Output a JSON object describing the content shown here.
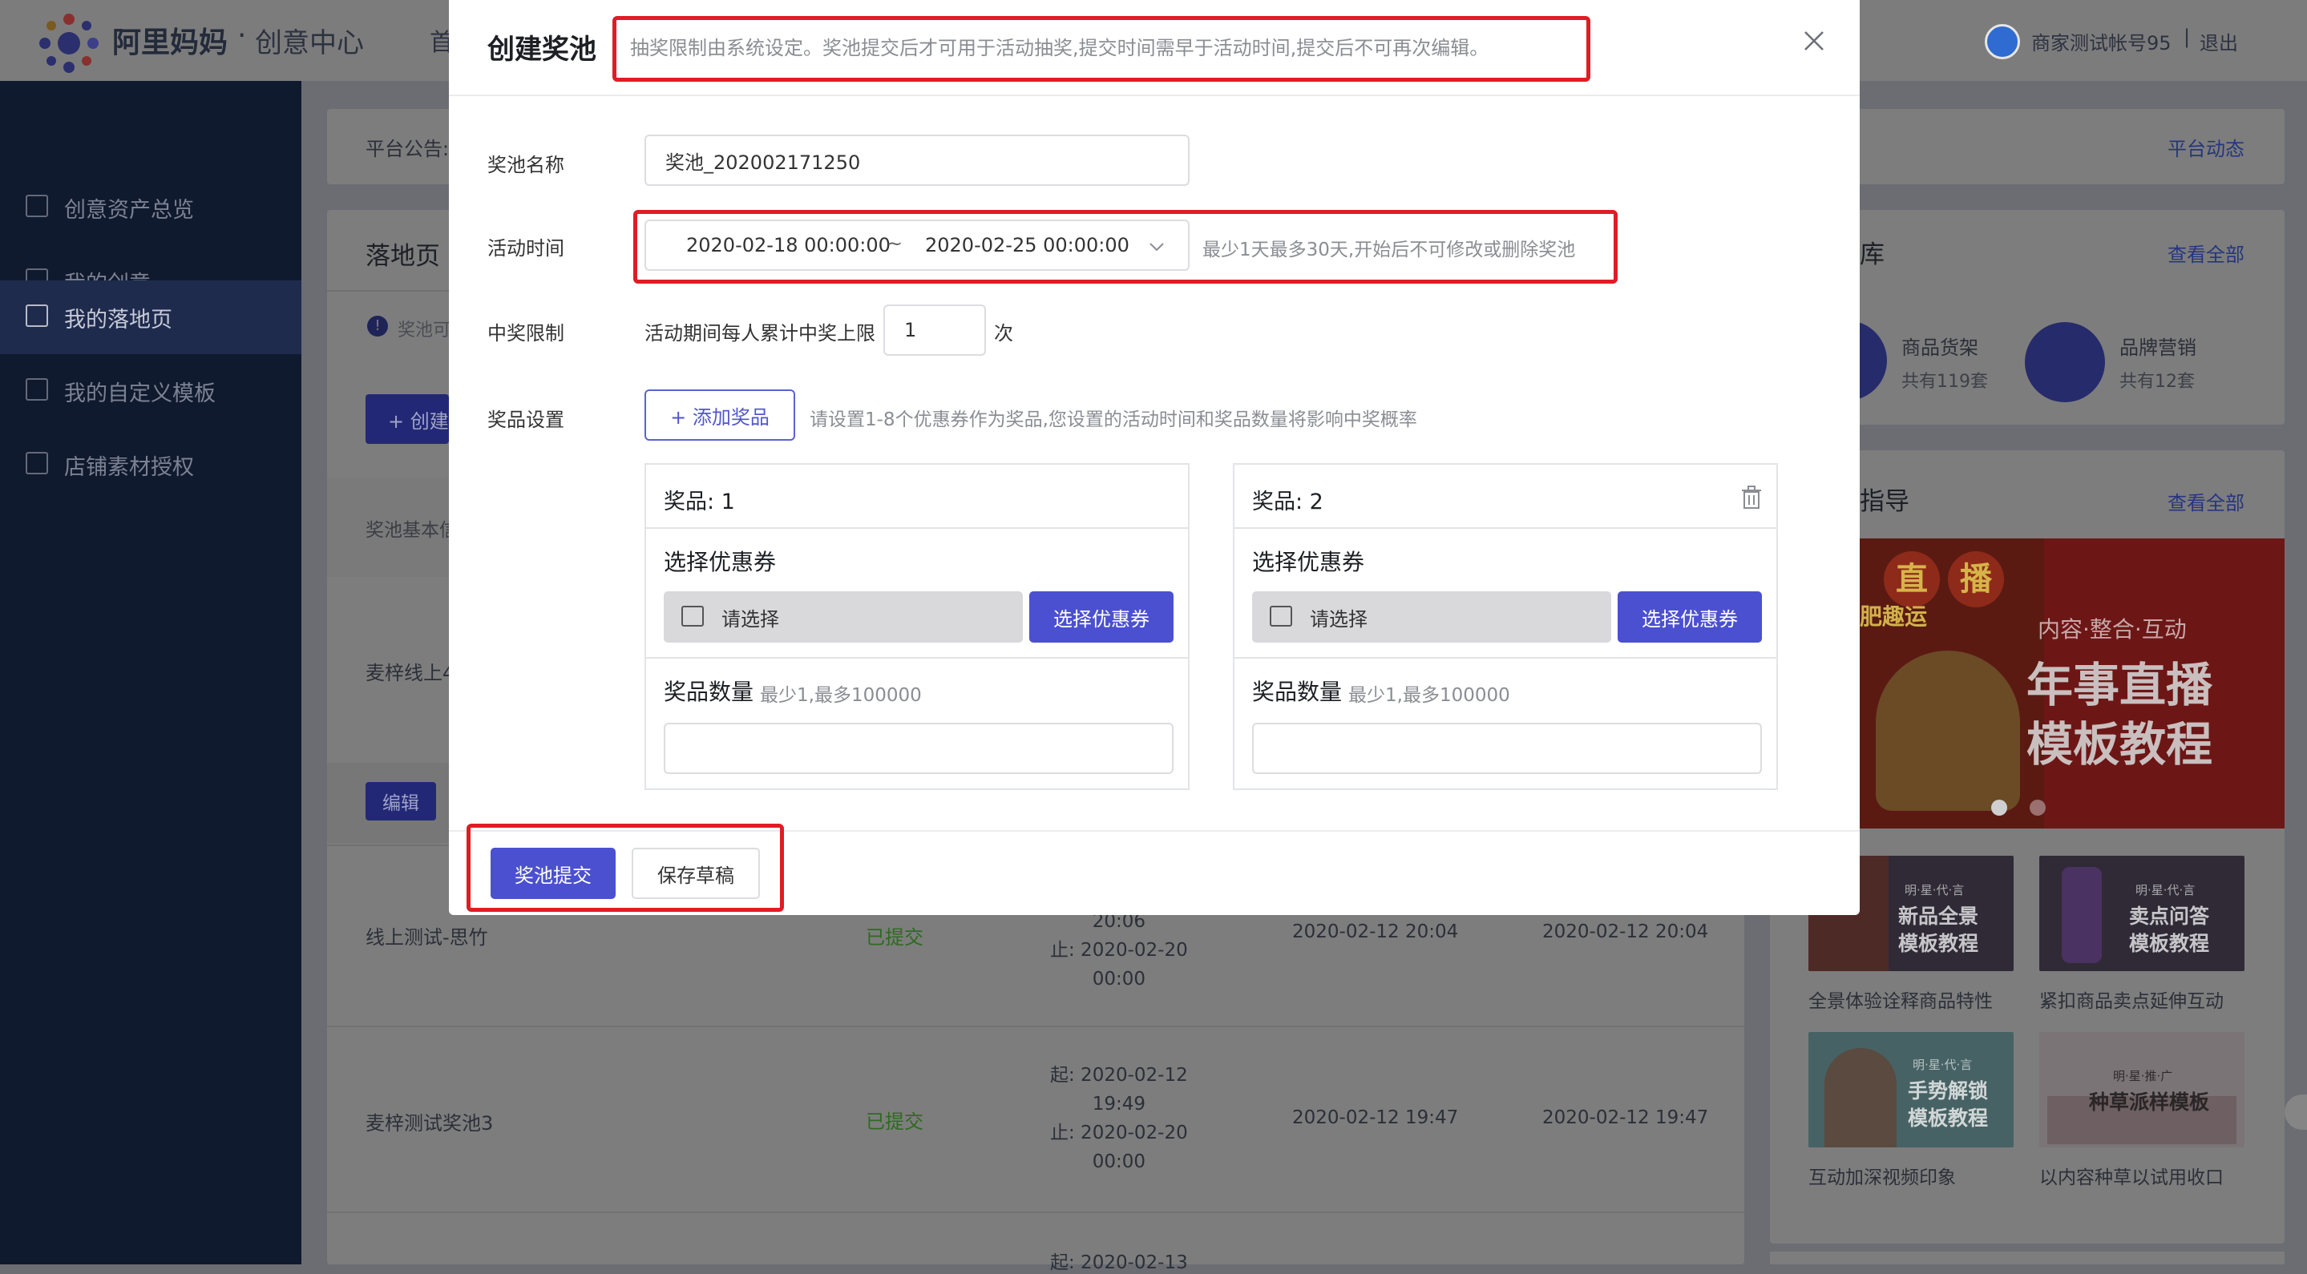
{
  "header": {
    "brand": "阿里妈妈",
    "brand_separator": "·",
    "brand_sub": "创意中心",
    "nav_first": "首",
    "user_name": "商家测试帐号95",
    "separator": "|",
    "logout": "退出"
  },
  "sidebar": {
    "items": [
      {
        "label": "创意资产总览",
        "icon": "monitor-icon"
      },
      {
        "label": "我的创意",
        "icon": "image-icon"
      },
      {
        "label": "我的落地页",
        "icon": "page-icon"
      },
      {
        "label": "我的自定义模板",
        "icon": "template-icon"
      },
      {
        "label": "店铺素材授权",
        "icon": "document-icon"
      }
    ],
    "active_index": 2
  },
  "background": {
    "announcement_label": "平台公告:",
    "platform_news": "平台动态",
    "landing_title": "落地页",
    "landing_note": "奖池可",
    "create_button": "+ 创建",
    "pool_basic": "奖池基本信",
    "row0_name": "麦梓线上4",
    "edit_button": "编辑",
    "rows": [
      {
        "name": "线上测试-思竹",
        "status": "已提交",
        "time_lines": [
          "20:06",
          "止:  2020-02-20",
          "00:00"
        ],
        "created": "2020-02-12 20:04",
        "updated": "2020-02-12 20:04"
      },
      {
        "name": "麦梓测试奖池3",
        "status": "已提交",
        "time_lines": [
          "起:  2020-02-12",
          "19:49",
          "止:  2020-02-20",
          "00:00"
        ],
        "created": "2020-02-12 19:47",
        "updated": "2020-02-12 19:47"
      }
    ],
    "row3_partial": "起:  2020-02-13",
    "library": {
      "title": "库",
      "view_all": "查看全部",
      "items": [
        {
          "name": "商品货架",
          "count": "共有119套"
        },
        {
          "name": "品牌营销",
          "count": "共有12套"
        }
      ]
    },
    "guide": {
      "title": "指导",
      "view_all": "查看全部",
      "banner_tags": [
        "直",
        "播"
      ],
      "banner_tag2": "肥趣运",
      "banner_small": "内容·整合·互动",
      "banner_big_1": "年事直播",
      "banner_big_2": "模板教程",
      "tiles": [
        {
          "caption": "全景体验诠释商品特性",
          "top": "明·星·代·言",
          "line1": "新品全景",
          "line2": "模板教程"
        },
        {
          "caption": "紧扣商品卖点延伸互动",
          "top": "明·星·代·言",
          "line1": "卖点问答",
          "line2": "模板教程"
        },
        {
          "caption": "互动加深视频印象",
          "top": "明·星·代·言",
          "line1": "手势解锁",
          "line2": "模板教程"
        },
        {
          "caption": "以内容种草以试用收口",
          "top": "明·星·推·广",
          "line1": "种草派样模板",
          "line2": ""
        }
      ]
    }
  },
  "modal": {
    "title": "创建奖池",
    "note": "抽奖限制由系统设定。奖池提交后才可用于活动抽奖,提交时间需早于活动时间,提交后不可再次编辑。",
    "fields": {
      "name_label": "奖池名称",
      "name_value": "奖池_202002171250",
      "time_label": "活动时间",
      "time_start": "2020-02-18 00:00:00",
      "time_sep": "~",
      "time_end": "2020-02-25 00:00:00",
      "time_hint": "最少1天最多30天,开始后不可修改或删除奖池",
      "limit_label": "中奖限制",
      "limit_prefix": "活动期间每人累计中奖上限",
      "limit_value": "1",
      "limit_unit": "次",
      "prize_label": "奖品设置",
      "add_prize": "+ 添加奖品",
      "prize_hint": "请设置1-8个优惠券作为奖品,您设置的活动时间和奖品数量将影响中奖概率"
    },
    "prizes": [
      {
        "title": "奖品:  1",
        "coupon_label": "选择优惠券",
        "select_placeholder": "请选择",
        "select_button": "选择优惠券",
        "qty_label": "奖品数量",
        "qty_hint": "最少1,最多100000",
        "qty_value": "",
        "deletable": false
      },
      {
        "title": "奖品:  2",
        "coupon_label": "选择优惠券",
        "select_placeholder": "请选择",
        "select_button": "选择优惠券",
        "qty_label": "奖品数量",
        "qty_hint": "最少1,最多100000",
        "qty_value": "",
        "deletable": true
      }
    ],
    "submit": "奖池提交",
    "save_draft": "保存草稿"
  },
  "colors": {
    "primary": "#4b50d0",
    "highlight": "#e01c25",
    "sidebar_bg": "#101a2e"
  }
}
